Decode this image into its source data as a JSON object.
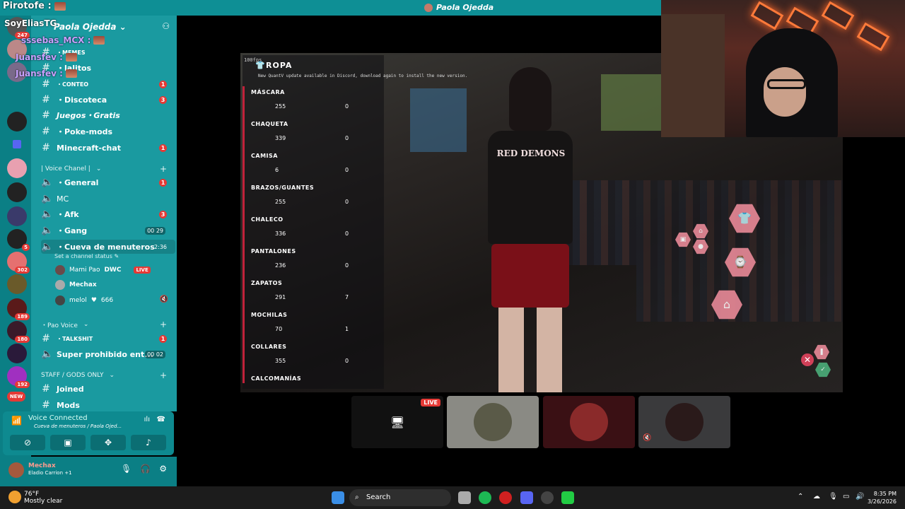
{
  "window": {
    "title": "Paola Ojedda"
  },
  "overlay_chat": [
    {
      "name": "Pirotofe :"
    },
    {
      "name": "SoyEliasTG"
    },
    {
      "name": "sssebas_MCX :"
    },
    {
      "name": "Juansfev :"
    },
    {
      "name": "Juansfev :"
    }
  ],
  "guild_badges": [
    "247",
    "5",
    "302",
    "189",
    "180",
    "192",
    "NEW"
  ],
  "server": {
    "name": "Paola Ojedda"
  },
  "channels": [
    {
      "label": "・MEMES",
      "type": "text"
    },
    {
      "label": "・lalitos",
      "type": "text"
    },
    {
      "label": "・CONTEO",
      "type": "text",
      "count": "1"
    },
    {
      "label": "・Discoteca",
      "type": "text",
      "count": "3"
    },
    {
      "label": "Juegos・Gratis",
      "type": "text"
    },
    {
      "label": "・Poke-mods",
      "type": "text"
    },
    {
      "label": "Minecraft-chat",
      "type": "text",
      "count": "1"
    }
  ],
  "voice_category": "| Voice Chanel |",
  "voice_channels": [
    {
      "label": "・General",
      "count": "1"
    },
    {
      "label": "MC"
    },
    {
      "label": "・Afk",
      "count": "3"
    },
    {
      "label": "・Gang",
      "pill": "00 29"
    },
    {
      "label": "・Cueva de menuteros",
      "time": "2:36"
    }
  ],
  "channel_status": "Set a channel status",
  "members": [
    {
      "name": "Mami Pao",
      "tag": "DWC",
      "live": "LIVE"
    },
    {
      "name": "Mechax"
    },
    {
      "name": "melol",
      "score": "666"
    }
  ],
  "pao_voice": {
    "category": "・Pao Voice",
    "talkshit": "・TALKSHIT",
    "talkshit_count": "1",
    "super": "Super prohibido ent...",
    "super_pill": "00 02"
  },
  "staff": {
    "category": "STAFF / GODS ONLY",
    "joined": "Joined",
    "mods": "Mods"
  },
  "voice_connected": {
    "status": "Voice Connected",
    "sub": "Cueva de menuteros / Paola Ojed..."
  },
  "user": {
    "name": "Mechax",
    "activity": "Eladio Carrion +1"
  },
  "ropa": {
    "fps": "100fps",
    "title": "ROPA",
    "update": "New QuantV update available in Discord, download again to install the new version.",
    "sections": [
      {
        "name": "MÁSCARA",
        "v1": "255",
        "v2": "0"
      },
      {
        "name": "CHAQUETA",
        "v1": "339",
        "v2": "0"
      },
      {
        "name": "CAMISA",
        "v1": "6",
        "v2": "0"
      },
      {
        "name": "BRAZOS/GUANTES",
        "v1": "255",
        "v2": "0"
      },
      {
        "name": "CHALECO",
        "v1": "336",
        "v2": "0"
      },
      {
        "name": "PANTALONES",
        "v1": "236",
        "v2": "0"
      },
      {
        "name": "ZAPATOS",
        "v1": "291",
        "v2": "7"
      },
      {
        "name": "MOCHILAS",
        "v1": "70",
        "v2": "1"
      },
      {
        "name": "COLLARES",
        "v1": "355",
        "v2": "0"
      },
      {
        "name": "CALCOMANÍAS",
        "v1": "",
        "v2": ""
      }
    ]
  },
  "character_logo": "RED DEMONS",
  "tiles": {
    "live": "LIVE"
  },
  "taskbar": {
    "temp": "76°F",
    "weather": "Mostly clear",
    "search": "Search",
    "time": "8:35 PM",
    "date": "3/26/2026"
  }
}
